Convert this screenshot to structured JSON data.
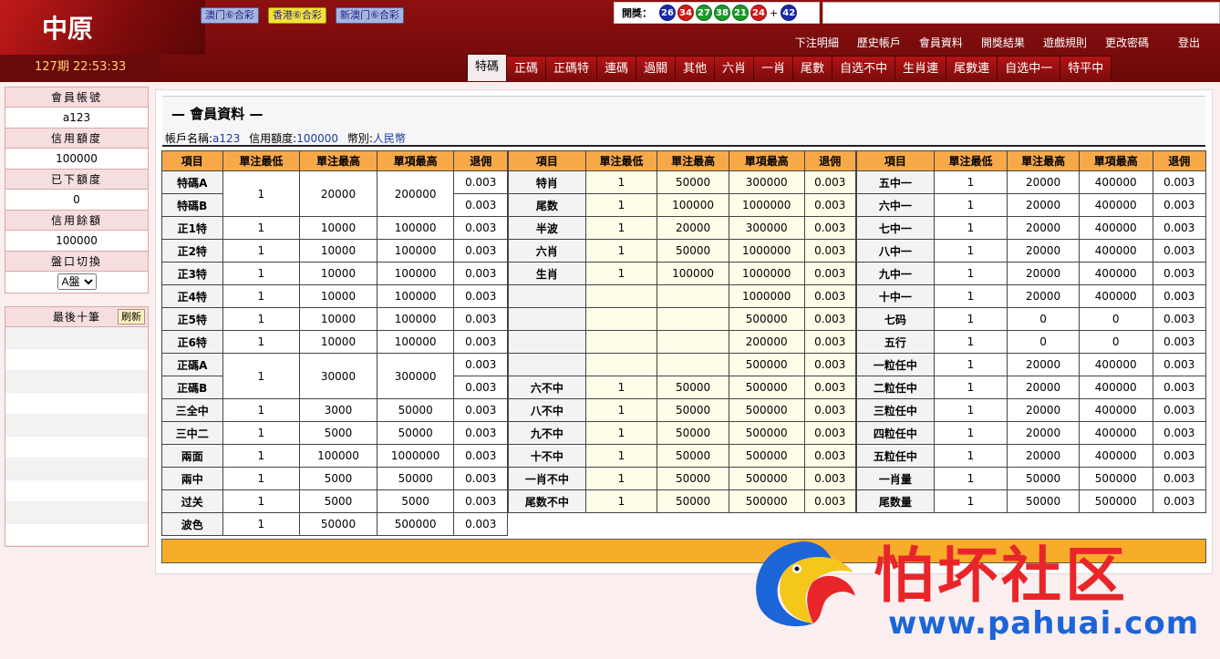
{
  "header": {
    "logo": "中原",
    "period_time": "127期 22:53:33",
    "game_tabs": [
      {
        "label": "澳门⑥合彩",
        "active": false
      },
      {
        "label": "香港⑥合彩",
        "active": true
      },
      {
        "label": "新澳门⑥合彩",
        "active": false
      }
    ],
    "result_label": "開獎：",
    "balls": [
      {
        "n": "26",
        "color": "#1a2aa8"
      },
      {
        "n": "34",
        "color": "#d11a1a"
      },
      {
        "n": "27",
        "color": "#1a9a2a"
      },
      {
        "n": "38",
        "color": "#1a9a2a"
      },
      {
        "n": "21",
        "color": "#1a9a2a"
      },
      {
        "n": "24",
        "color": "#d11a1a"
      },
      {
        "n": "42",
        "color": "#1a2aa8"
      }
    ],
    "plus": "+",
    "links": [
      "下注明細",
      "歷史帳戶",
      "會員資料",
      "開獎結果",
      "遊戲規則",
      "更改密碼",
      "登出"
    ],
    "nav_tabs": [
      {
        "label": "特碼",
        "active": true
      },
      {
        "label": "正碼",
        "active": false
      },
      {
        "label": "正碼特",
        "active": false
      },
      {
        "label": "連碼",
        "active": false
      },
      {
        "label": "過關",
        "active": false
      },
      {
        "label": "其他",
        "active": false
      },
      {
        "label": "六肖",
        "active": false
      },
      {
        "label": "一肖",
        "active": false
      },
      {
        "label": "尾數",
        "active": false
      },
      {
        "label": "自选不中",
        "active": false
      },
      {
        "label": "生肖連",
        "active": false
      },
      {
        "label": "尾數連",
        "active": false
      },
      {
        "label": "自选中一",
        "active": false
      },
      {
        "label": "特平中",
        "active": false
      }
    ]
  },
  "sidebar": {
    "account_label": "會員帳號",
    "account": "a123",
    "credit_label": "信用額度",
    "credit": "100000",
    "placed_label": "已下額度",
    "placed": "0",
    "balance_label": "信用餘額",
    "balance": "100000",
    "switch_label": "盤口切換",
    "switch_value": "A盤",
    "recent_label": "最後十筆",
    "refresh": "刷新"
  },
  "main": {
    "title": "— 會員資料 —",
    "acct_name_label": "帳戶名稱:",
    "acct_name": "a123",
    "credit_label": "信用額度:",
    "credit": "100000",
    "currency_label": "幣別:",
    "currency": "人民幣",
    "headers": [
      "項目",
      "單注最低",
      "單注最高",
      "單項最高",
      "退佣"
    ],
    "col1": [
      [
        "特碼A",
        "1",
        "20000",
        "200000",
        "0.003"
      ],
      [
        "特碼B",
        "",
        "",
        "",
        "0.003"
      ],
      [
        "正1特",
        "1",
        "10000",
        "100000",
        "0.003"
      ],
      [
        "正2特",
        "1",
        "10000",
        "100000",
        "0.003"
      ],
      [
        "正3特",
        "1",
        "10000",
        "100000",
        "0.003"
      ],
      [
        "正4特",
        "1",
        "10000",
        "100000",
        "0.003"
      ],
      [
        "正5特",
        "1",
        "10000",
        "100000",
        "0.003"
      ],
      [
        "正6特",
        "1",
        "10000",
        "100000",
        "0.003"
      ],
      [
        "正碼A",
        "1",
        "30000",
        "300000",
        "0.003"
      ],
      [
        "正碼B",
        "",
        "",
        "",
        "0.003"
      ],
      [
        "三全中",
        "1",
        "3000",
        "50000",
        "0.003"
      ],
      [
        "三中二",
        "1",
        "5000",
        "50000",
        "0.003"
      ],
      [
        "兩面",
        "1",
        "100000",
        "1000000",
        "0.003"
      ],
      [
        "兩中",
        "1",
        "5000",
        "50000",
        "0.003"
      ],
      [
        "过关",
        "1",
        "5000",
        "5000",
        "0.003"
      ],
      [
        "波色",
        "1",
        "50000",
        "500000",
        "0.003"
      ]
    ],
    "col2": [
      [
        "特肖",
        "1",
        "50000",
        "300000",
        "0.003"
      ],
      [
        "尾数",
        "1",
        "100000",
        "1000000",
        "0.003"
      ],
      [
        "半波",
        "1",
        "20000",
        "300000",
        "0.003"
      ],
      [
        "六肖",
        "1",
        "50000",
        "1000000",
        "0.003"
      ],
      [
        "生肖",
        "1",
        "100000",
        "1000000",
        "0.003"
      ],
      [
        "",
        "",
        "",
        "1000000",
        "0.003"
      ],
      [
        "",
        "",
        "",
        "500000",
        "0.003"
      ],
      [
        "",
        "",
        "",
        "200000",
        "0.003"
      ],
      [
        "",
        "",
        "",
        "500000",
        "0.003"
      ],
      [
        "六不中",
        "1",
        "50000",
        "500000",
        "0.003"
      ],
      [
        "八不中",
        "1",
        "50000",
        "500000",
        "0.003"
      ],
      [
        "九不中",
        "1",
        "50000",
        "500000",
        "0.003"
      ],
      [
        "十不中",
        "1",
        "50000",
        "500000",
        "0.003"
      ],
      [
        "一肖不中",
        "1",
        "50000",
        "500000",
        "0.003"
      ],
      [
        "尾数不中",
        "1",
        "50000",
        "500000",
        "0.003"
      ]
    ],
    "col3": [
      [
        "五中一",
        "1",
        "20000",
        "400000",
        "0.003"
      ],
      [
        "六中一",
        "1",
        "20000",
        "400000",
        "0.003"
      ],
      [
        "七中一",
        "1",
        "20000",
        "400000",
        "0.003"
      ],
      [
        "八中一",
        "1",
        "20000",
        "400000",
        "0.003"
      ],
      [
        "九中一",
        "1",
        "20000",
        "400000",
        "0.003"
      ],
      [
        "十中一",
        "1",
        "20000",
        "400000",
        "0.003"
      ],
      [
        "七码",
        "1",
        "0",
        "0",
        "0.003"
      ],
      [
        "五行",
        "1",
        "0",
        "0",
        "0.003"
      ],
      [
        "一粒任中",
        "1",
        "20000",
        "400000",
        "0.003"
      ],
      [
        "二粒任中",
        "1",
        "20000",
        "400000",
        "0.003"
      ],
      [
        "三粒任中",
        "1",
        "20000",
        "400000",
        "0.003"
      ],
      [
        "四粒任中",
        "1",
        "20000",
        "400000",
        "0.003"
      ],
      [
        "五粒任中",
        "1",
        "20000",
        "400000",
        "0.003"
      ],
      [
        "一肖量",
        "1",
        "50000",
        "500000",
        "0.003"
      ],
      [
        "尾数量",
        "1",
        "50000",
        "500000",
        "0.003"
      ]
    ]
  },
  "watermark": {
    "cn": "怕坏社区",
    "url": "www.pahuai.com"
  }
}
